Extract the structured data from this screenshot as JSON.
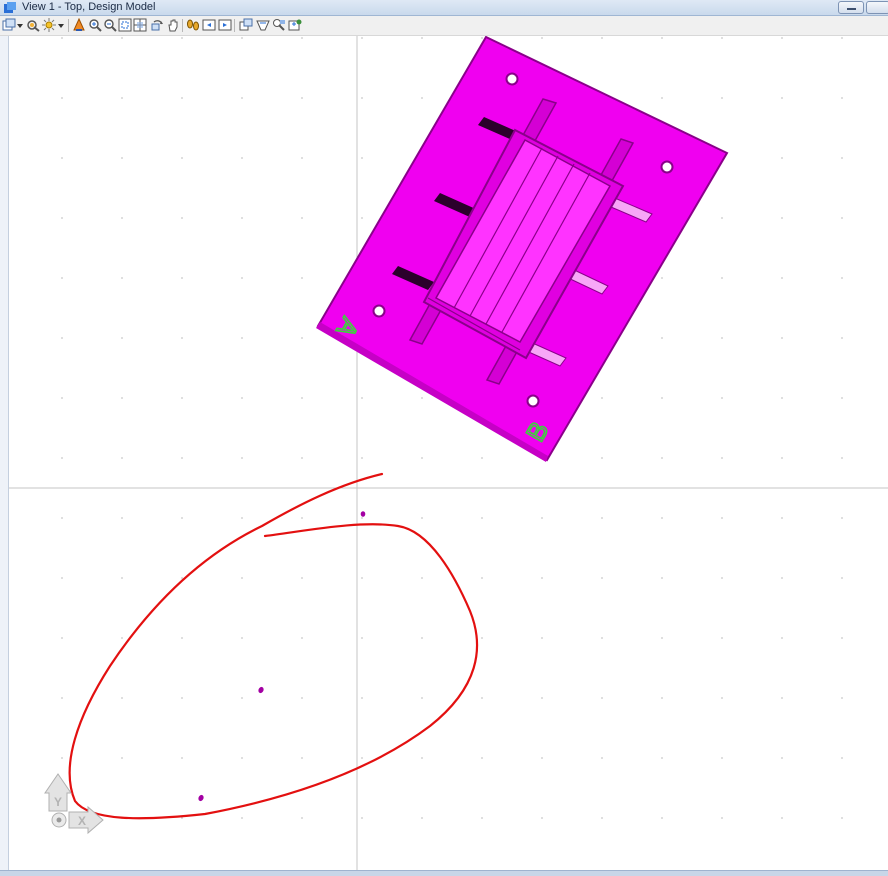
{
  "window": {
    "title": "View 1 - Top, Design Model"
  },
  "toolbar": {
    "buttons": [
      {
        "icon": "view-attributes-icon",
        "label": "View Attributes"
      },
      {
        "icon": "dropdown-arrow-icon",
        "label": "More"
      },
      {
        "icon": "display-style-icon",
        "label": "Display Style"
      },
      {
        "icon": "lighting-icon",
        "label": "Lighting"
      },
      {
        "icon": "dropdown-arrow-icon",
        "label": "More"
      },
      {
        "icon": "update-view-icon",
        "label": "Update View"
      },
      {
        "icon": "zoom-in-icon",
        "label": "Zoom In"
      },
      {
        "icon": "zoom-out-icon",
        "label": "Zoom Out"
      },
      {
        "icon": "window-area-icon",
        "label": "Window Area"
      },
      {
        "icon": "fit-view-icon",
        "label": "Fit View"
      },
      {
        "icon": "rotate-view-icon",
        "label": "Rotate View"
      },
      {
        "icon": "pan-view-icon",
        "label": "Pan View"
      },
      {
        "icon": "walk-icon",
        "label": "Walk"
      },
      {
        "icon": "previous-view-icon",
        "label": "View Previous"
      },
      {
        "icon": "next-view-icon",
        "label": "View Next"
      },
      {
        "icon": "toggle-camera-icon",
        "label": "Toggle Camera"
      },
      {
        "icon": "clip-volume-icon",
        "label": "Clip Volume"
      },
      {
        "icon": "clip-mask-icon",
        "label": "Clip Mask"
      },
      {
        "icon": "copy-view-icon",
        "label": "Copy View"
      }
    ]
  },
  "model": {
    "labels": [
      "A",
      "B"
    ],
    "fill_color": "#f000f0",
    "edge_color": "#8a008a",
    "label_color": "#3bd43b"
  },
  "markup": {
    "annotation_color": "#e31010",
    "point_color": "#a300a3"
  },
  "view_cube": {
    "y_axis": "Y",
    "x_axis": "X"
  },
  "colors": {
    "grid_dot": "#c8c8c8",
    "axis_line": "#c6c6c6"
  }
}
